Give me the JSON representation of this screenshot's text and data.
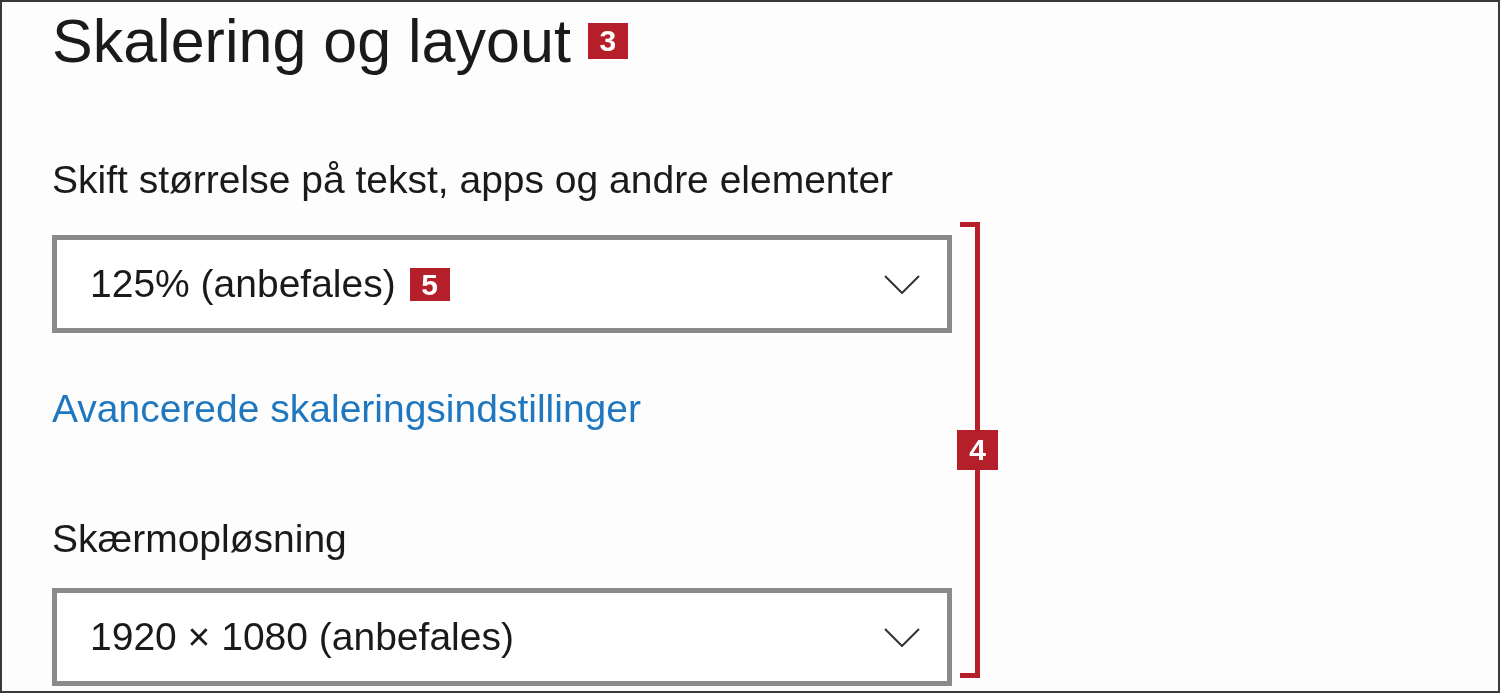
{
  "section": {
    "title": "Skalering og layout",
    "callout": "3"
  },
  "scale": {
    "label": "Skift størrelse på tekst, apps og andre elementer",
    "value": "125% (anbefales)",
    "callout": "5"
  },
  "advanced_link": "Avancerede skaleringsindstillinger",
  "resolution": {
    "label": "Skærmopløsning",
    "value": "1920 × 1080 (anbefales)"
  },
  "bracket": {
    "callout": "4"
  }
}
